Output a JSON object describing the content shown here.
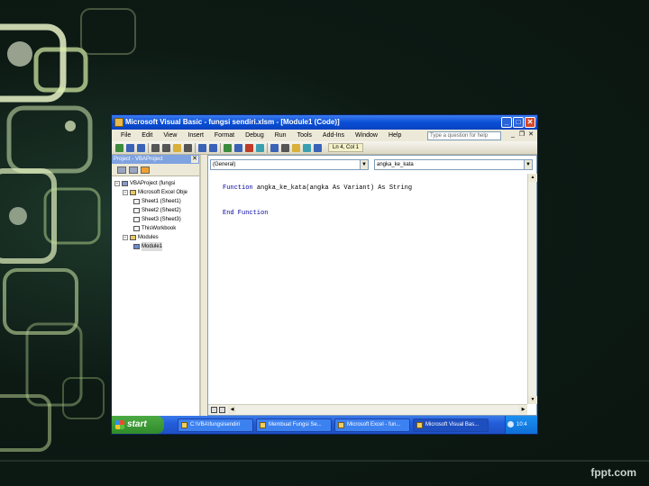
{
  "window": {
    "title": "Microsoft Visual Basic - fungsi sendiri.xlsm - [Module1 (Code)]",
    "min": "_",
    "max": "□",
    "close": "✕"
  },
  "menubar": {
    "items": [
      "File",
      "Edit",
      "View",
      "Insert",
      "Format",
      "Debug",
      "Run",
      "Tools",
      "Add-Ins",
      "Window",
      "Help"
    ],
    "ask_placeholder": "Type a question for help",
    "doc_min": "_",
    "doc_max": "❐",
    "doc_close": "✕"
  },
  "toolbar": {
    "position": "Ln 4, Col 1"
  },
  "project": {
    "title": "Project - VBAProject",
    "close": "✕",
    "tree": [
      {
        "label": "VBAProject (fungsi",
        "exp": "−"
      },
      {
        "label": "Microsoft Excel Obje",
        "exp": "−"
      },
      {
        "label": "Sheet1 (Sheet1)"
      },
      {
        "label": "Sheet2 (Sheet2)"
      },
      {
        "label": "Sheet3 (Sheet3)"
      },
      {
        "label": "ThisWorkbook"
      },
      {
        "label": "Modules",
        "exp": "−"
      },
      {
        "label": "Module1"
      }
    ]
  },
  "code": {
    "object_combo": "(General)",
    "proc_combo": "angka_ke_kata",
    "lines": [
      {
        "kw": "Function ",
        "rest": "angka_ke_kata(angka As Variant) As String"
      },
      {
        "kw": "",
        "rest": ""
      },
      {
        "kw": "End Function",
        "rest": ""
      }
    ]
  },
  "taskbar": {
    "start": "start",
    "tasks": [
      "C:\\VBA\\fungsisendiri",
      "Membuat Fungsi Se...",
      "Microsoft Excel - fun...",
      "Microsoft Visual Bas..."
    ],
    "tray": "10:4"
  },
  "watermark": "fppt.com"
}
